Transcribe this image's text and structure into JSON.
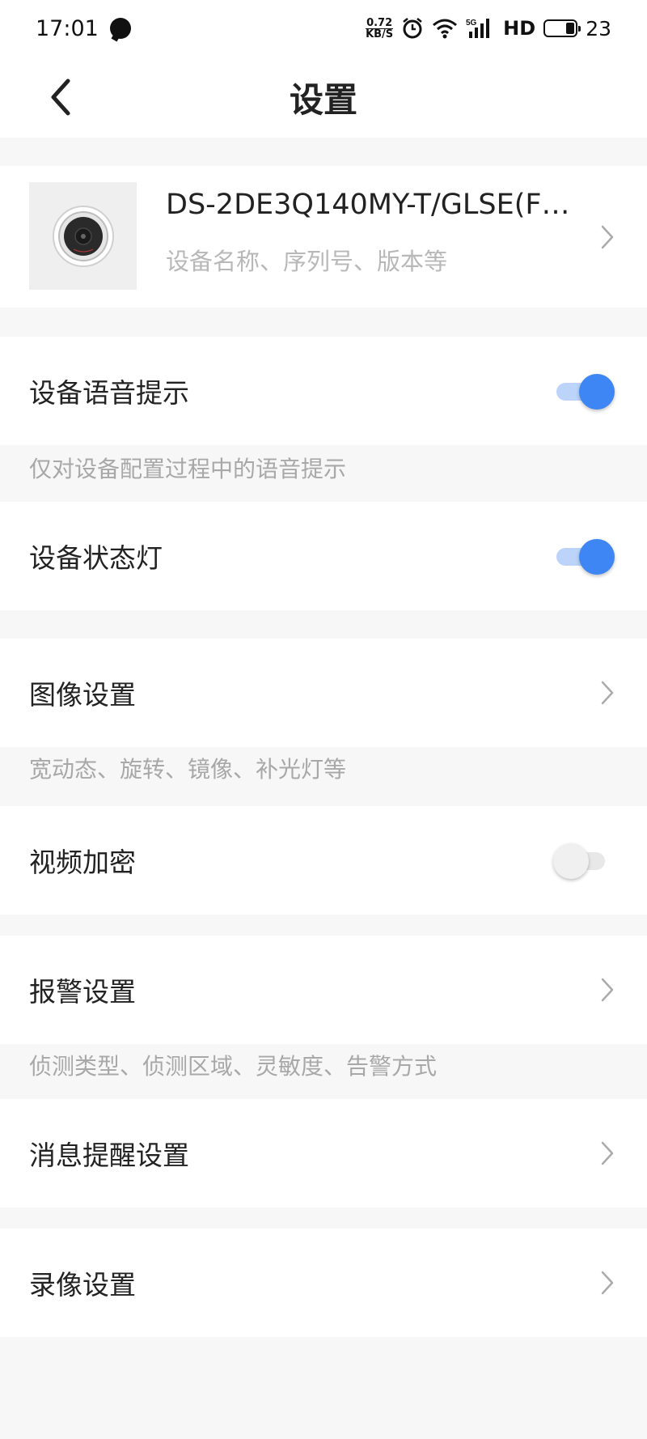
{
  "status_bar": {
    "time": "17:01",
    "net_speed_top": "0.72",
    "net_speed_bottom": "KB/S",
    "signal_label": "5G",
    "hd_label": "HD",
    "battery": "23",
    "icons": [
      "message-dot-icon",
      "alarm-icon",
      "wifi-icon",
      "cell-signal-icon",
      "battery-icon"
    ]
  },
  "header": {
    "title": "设置",
    "back_icon": "chevron-left-icon"
  },
  "device": {
    "name": "DS-2DE3Q140MY-T/GLSE(F8...",
    "subtitle": "设备名称、序列号、版本等",
    "thumb_icon": "camera-lens-icon"
  },
  "settings": {
    "voice_prompt": {
      "label": "设备语音提示",
      "on": true,
      "hint": "仅对设备配置过程中的语音提示"
    },
    "status_light": {
      "label": "设备状态灯",
      "on": true
    },
    "image": {
      "label": "图像设置",
      "hint": "宽动态、旋转、镜像、补光灯等"
    },
    "video_encrypt": {
      "label": "视频加密",
      "on": false
    },
    "alarm": {
      "label": "报警设置",
      "hint": "侦测类型、侦测区域、灵敏度、告警方式"
    },
    "notification": {
      "label": "消息提醒设置"
    },
    "recording": {
      "label": "录像设置"
    }
  },
  "colors": {
    "accent": "#3d86f4",
    "background": "#f7f7f7",
    "card": "#ffffff",
    "hint_text": "#a8a8a8"
  }
}
